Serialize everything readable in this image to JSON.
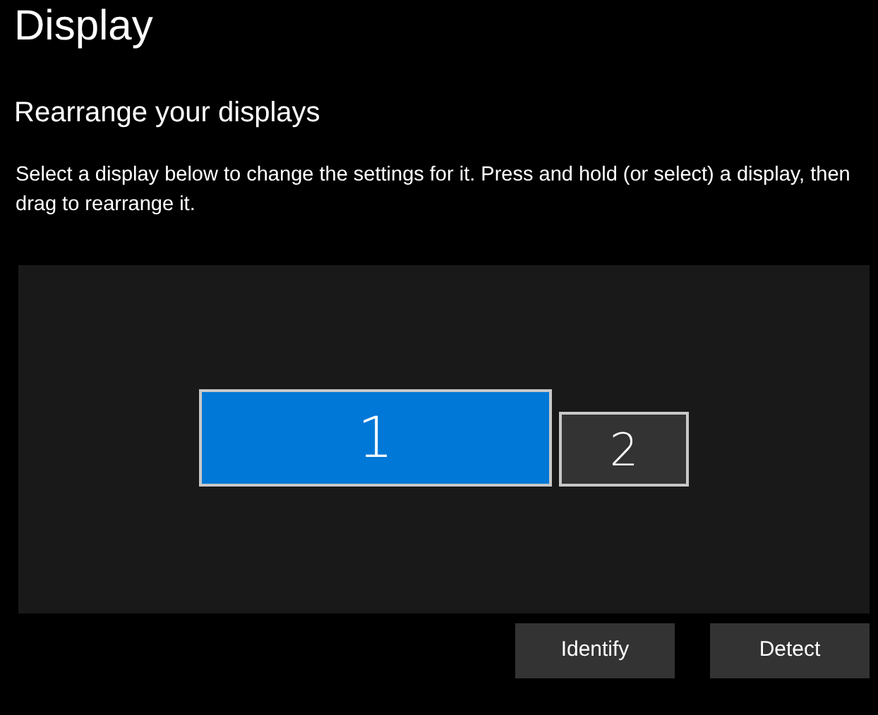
{
  "title": "Display",
  "section": {
    "heading": "Rearrange your displays",
    "description": "Select a display below to change the settings for it. Press and hold (or select) a display, then drag to rearrange it."
  },
  "displays": [
    {
      "label": "1",
      "selected": true
    },
    {
      "label": "2",
      "selected": false
    }
  ],
  "buttons": [
    "Identify",
    "Detect"
  ]
}
